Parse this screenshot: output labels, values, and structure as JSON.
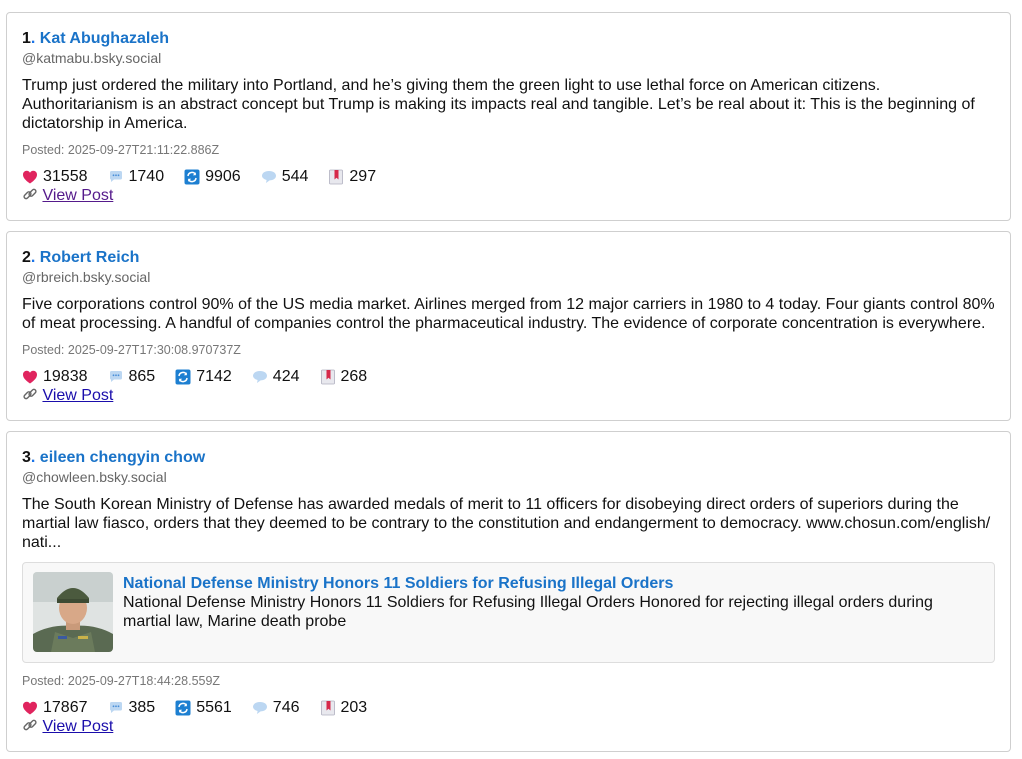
{
  "posts": [
    {
      "num": "1",
      "author": "Kat Abughazaleh",
      "handle": "@katmabu.bsky.social",
      "text": "Trump just ordered the military into Portland, and he’s giving them the green light to use lethal force on American citizens. Authoritarianism is an abstract concept but Trump is making its impacts real and tangible. Let’s be real about it: This is the beginning of dictatorship in America.",
      "posted": "Posted: 2025-09-27T21:11:22.886Z",
      "likes": "31558",
      "replies": "1740",
      "reposts": "9906",
      "quotes": "544",
      "bookmarks": "297",
      "view_label": "View Post"
    },
    {
      "num": "2",
      "author": "Robert Reich",
      "handle": "@rbreich.bsky.social",
      "text": "Five corporations control 90% of the US media market. Airlines merged from 12 major carriers in 1980 to 4 today. Four giants control 80% of meat processing. A handful of companies control the pharmaceutical industry. The evidence of corporate concentration is everywhere.",
      "posted": "Posted: 2025-09-27T17:30:08.970737Z",
      "likes": "19838",
      "replies": "865",
      "reposts": "7142",
      "quotes": "424",
      "bookmarks": "268",
      "view_label": "View Post"
    },
    {
      "num": "3",
      "author": "eileen chengyin chow",
      "handle": "@chowleen.bsky.social",
      "text": "The South Korean Ministry of Defense has awarded medals of merit to 11 officers for disobeying direct orders of superiors during the martial law fiasco, orders that they deemed to be contrary to the constitution and endangerment to democracy. www.chosun.com/english/ nati...",
      "link_title": "National Defense Ministry Honors 11 Soldiers for Refusing Illegal Orders",
      "link_desc": "National Defense Ministry Honors 11 Soldiers for Refusing Illegal Orders Honored for rejecting illegal orders during martial law, Marine death probe",
      "posted": "Posted: 2025-09-27T18:44:28.559Z",
      "likes": "17867",
      "replies": "385",
      "reposts": "5561",
      "quotes": "746",
      "bookmarks": "203",
      "view_label": "View Post"
    }
  ],
  "colors": {
    "author_link": "#1a73c8",
    "heart": "#e0245e",
    "repost": "#1d7fd1",
    "bookmark": "#d6294a"
  },
  "icons": [
    "heart-icon",
    "reply-bubble-icon",
    "repost-icon",
    "quote-bubble-icon",
    "bookmark-icon",
    "link-icon"
  ]
}
